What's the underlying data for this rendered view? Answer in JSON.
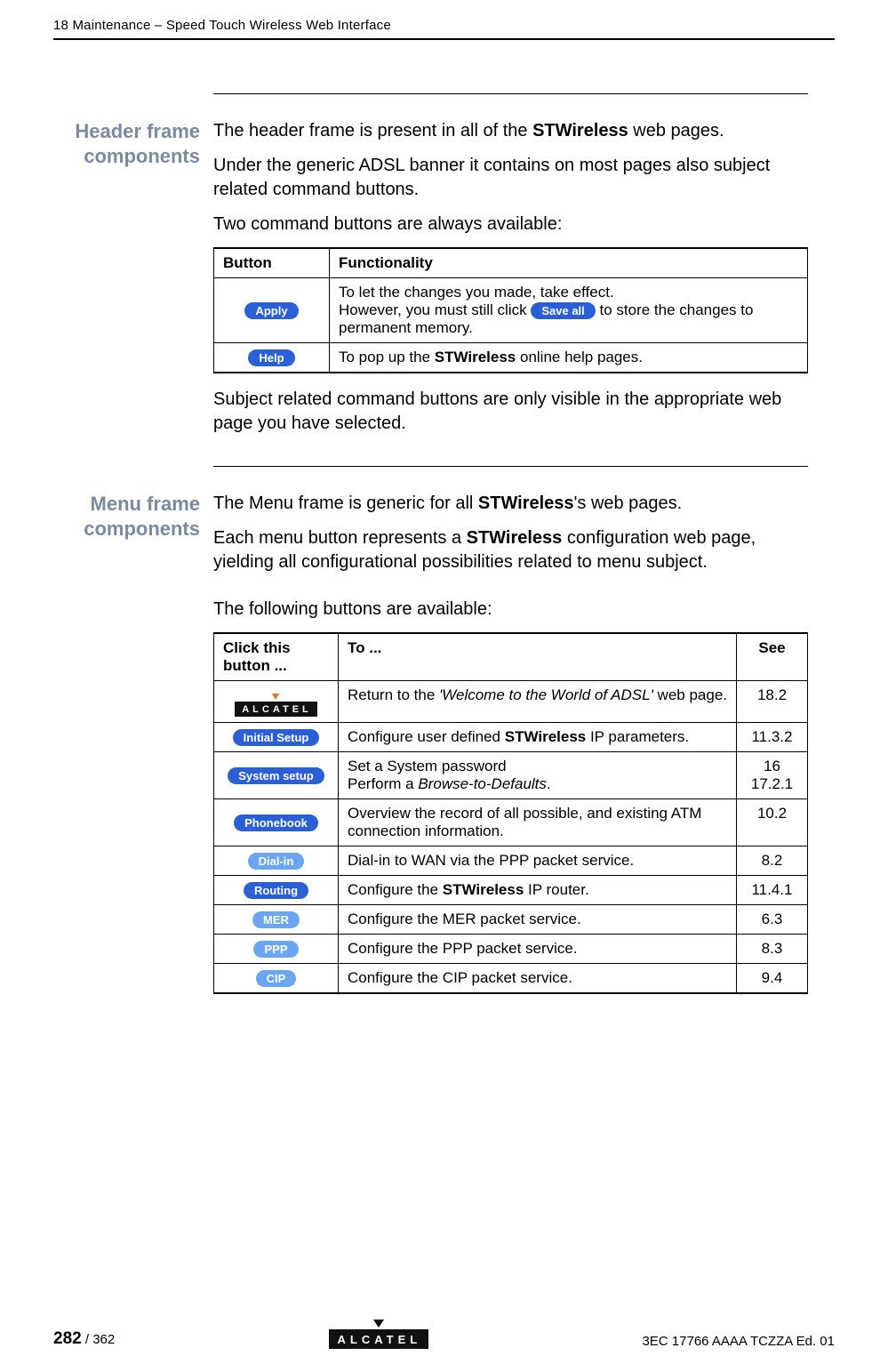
{
  "header_line": "18 Maintenance – Speed Touch Wireless Web Interface",
  "section1": {
    "side_head": "Header frame components",
    "p1a": "The header frame is present in all of the ",
    "p1b": "STWireless",
    "p1c": " web pages.",
    "p2": "Under the generic ADSL banner it contains on most pages also subject related command buttons.",
    "p3": "Two command buttons are always available:",
    "table": {
      "h1": "Button",
      "h2": "Functionality",
      "r1": {
        "btn": "Apply",
        "l1": "To let the changes you made, take effect.",
        "l2a": "However, you must still click ",
        "l2_btn": "Save all",
        "l2b": " to store the changes to permanent memory."
      },
      "r2": {
        "btn": "Help",
        "l1a": "To pop up the ",
        "l1b": "STWireless",
        "l1c": " online help pages."
      }
    },
    "p4": "Subject related command buttons are only visible in the appropriate web page you have selected."
  },
  "section2": {
    "side_head": "Menu frame components",
    "p1a": "The Menu frame is generic for all ",
    "p1b": "STWireless",
    "p1c": "'s web pages.",
    "p2a": "Each menu button represents a ",
    "p2b": "STWireless",
    "p2c": " configuration web page, yielding all configurational possibilities related to menu subject.",
    "p3": "The following buttons are available:",
    "table": {
      "h1": "Click this button ...",
      "h2": "To ...",
      "h3": "See",
      "rows": [
        {
          "btn": "ALCATEL",
          "kind": "logo",
          "to_a": "Return to the ",
          "to_i": "'Welcome to the World of ADSL'",
          "to_b": " web page.",
          "see": "18.2"
        },
        {
          "btn": "Initial Setup",
          "kind": "pill",
          "to_a": "Configure user defined ",
          "to_bold": "STWireless",
          "to_b": " IP parameters.",
          "see": "11.3.2"
        },
        {
          "btn": "System setup",
          "kind": "pill",
          "to_lines": [
            {
              "a": "Set a System password",
              "see": "16"
            },
            {
              "a": "Perform a ",
              "i": "Browse-to-Defaults",
              "b": ".",
              "see": "17.2.1"
            }
          ]
        },
        {
          "btn": "Phonebook",
          "kind": "pill",
          "to_a": "Overview the record of all possible, and existing ATM connection information.",
          "see": "10.2"
        },
        {
          "btn": "Dial-in",
          "kind": "pill-light",
          "to_a": "Dial-in to WAN via the PPP packet service.",
          "see": "8.2"
        },
        {
          "btn": "Routing",
          "kind": "pill",
          "to_a": "Configure the ",
          "to_bold": "STWireless",
          "to_b": " IP router.",
          "see": "11.4.1"
        },
        {
          "btn": "MER",
          "kind": "pill-light",
          "to_a": "Configure the MER packet service.",
          "see": "6.3"
        },
        {
          "btn": "PPP",
          "kind": "pill-light",
          "to_a": "Configure the PPP packet service.",
          "see": "8.3"
        },
        {
          "btn": "CIP",
          "kind": "pill-light",
          "to_a": "Configure the CIP packet service.",
          "see": "9.4"
        }
      ]
    }
  },
  "footer": {
    "page_cur": "282",
    "page_sep": " / ",
    "page_tot": "362",
    "logo": "ALCATEL",
    "doc_id": "3EC 17766 AAAA TCZZA Ed. 01"
  }
}
